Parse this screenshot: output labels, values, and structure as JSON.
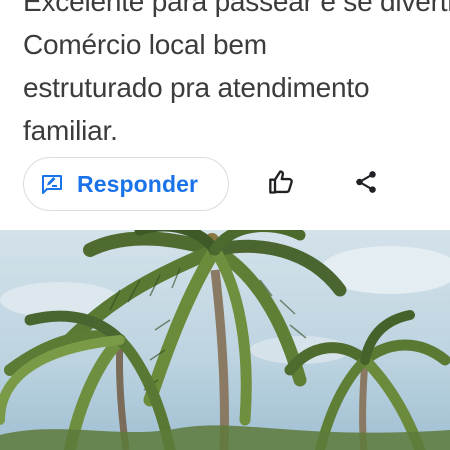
{
  "review": {
    "lines": [
      "Excelente para passear e se divertir, lugar",
      "Comércio local bem",
      "estruturado pra atendimento",
      "familiar."
    ]
  },
  "actions": {
    "reply_label": "Responder",
    "reply_icon": "rate-review-icon",
    "like_icon": "thumb-up-icon",
    "share_icon": "share-icon"
  },
  "photo": {
    "subject": "coconut-palm-trees-photo"
  },
  "colors": {
    "accent": "#1a73e8",
    "text": "#3c3c3c",
    "border": "#dadce0",
    "sky": "#c9dbe6"
  }
}
